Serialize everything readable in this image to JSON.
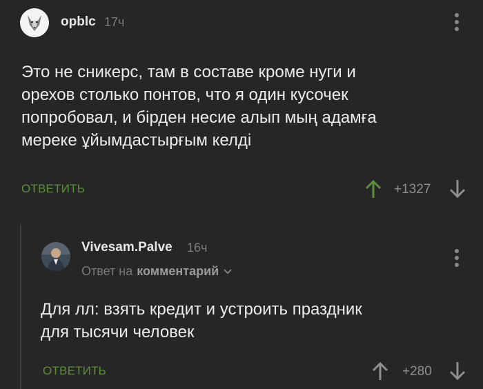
{
  "comment": {
    "username": "opblc",
    "time": "17ч",
    "text": "Это не сникерс, там в составе кроме нуги и\nорехов столько понтов, что я один кусочек\nпопробовал, и бірден несие алып мың адамға\nмереке ұйымдастырғым келді",
    "reply_label": "ОТВЕТИТЬ",
    "rating": "+1327"
  },
  "reply_comment": {
    "username": "Vivesam.Palve",
    "time": "16ч",
    "reply_to_prefix": "Ответ на",
    "reply_to_link": "комментарий",
    "text": "Для лл: взять кредит и устроить праздник\nдля тысячи человек",
    "reply_label": "ОТВЕТИТЬ",
    "rating": "+280"
  },
  "colors": {
    "background": "#262626",
    "accent_green": "#5e8f3a",
    "text": "#ebebeb",
    "muted": "#7a7a7a"
  },
  "icons": [
    "wolf-avatar",
    "man-avatar",
    "more-vert-icon",
    "arrow-up-icon",
    "arrow-down-icon",
    "chevron-down-icon"
  ]
}
